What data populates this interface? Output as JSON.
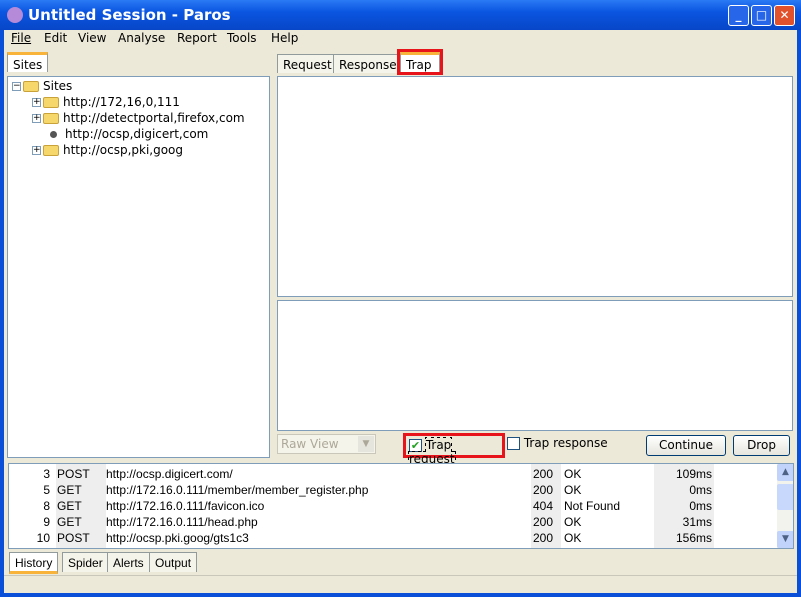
{
  "window": {
    "title": "Untitled Session - Paros",
    "minimize": "_",
    "maximize": "□",
    "close": "✕"
  },
  "menu": [
    "File",
    "Edit",
    "View",
    "Analyse",
    "Report",
    "Tools",
    "Help"
  ],
  "left": {
    "tab": "Sites",
    "tree": {
      "root": "Sites",
      "children": [
        {
          "label": "http://172,16,0,111",
          "type": "folder"
        },
        {
          "label": "http://detectportal,firefox,com",
          "type": "folder"
        },
        {
          "label": "http://ocsp,digicert,com",
          "type": "leaf"
        },
        {
          "label": "http://ocsp,pki,goog",
          "type": "folder"
        }
      ]
    }
  },
  "right": {
    "tabs": [
      "Request",
      "Response",
      "Trap"
    ],
    "selected_tab": "Trap",
    "view_select": "Raw View",
    "trap_request": {
      "label": "Trap request",
      "checked": true
    },
    "trap_response": {
      "label": "Trap response",
      "checked": false
    },
    "continue": "Continue",
    "drop": "Drop"
  },
  "history": {
    "rows": [
      {
        "id": "3",
        "method": "POST",
        "url": "http://ocsp.digicert.com/",
        "code": "200",
        "status": "OK",
        "time": "109ms"
      },
      {
        "id": "5",
        "method": "GET",
        "url": "http://172.16.0.111/member/member_register.php",
        "code": "200",
        "status": "OK",
        "time": "0ms"
      },
      {
        "id": "8",
        "method": "GET",
        "url": "http://172.16.0.111/favicon.ico",
        "code": "404",
        "status": "Not Found",
        "time": "0ms"
      },
      {
        "id": "9",
        "method": "GET",
        "url": "http://172.16.0.111/head.php",
        "code": "200",
        "status": "OK",
        "time": "31ms"
      },
      {
        "id": "10",
        "method": "POST",
        "url": "http://ocsp.pki.goog/gts1c3",
        "code": "200",
        "status": "OK",
        "time": "156ms"
      }
    ]
  },
  "bottom_tabs": [
    "History",
    "Spider",
    "Alerts",
    "Output"
  ],
  "colors": {
    "highlight": "#e8141c",
    "titlebar": "#0a55e0"
  }
}
